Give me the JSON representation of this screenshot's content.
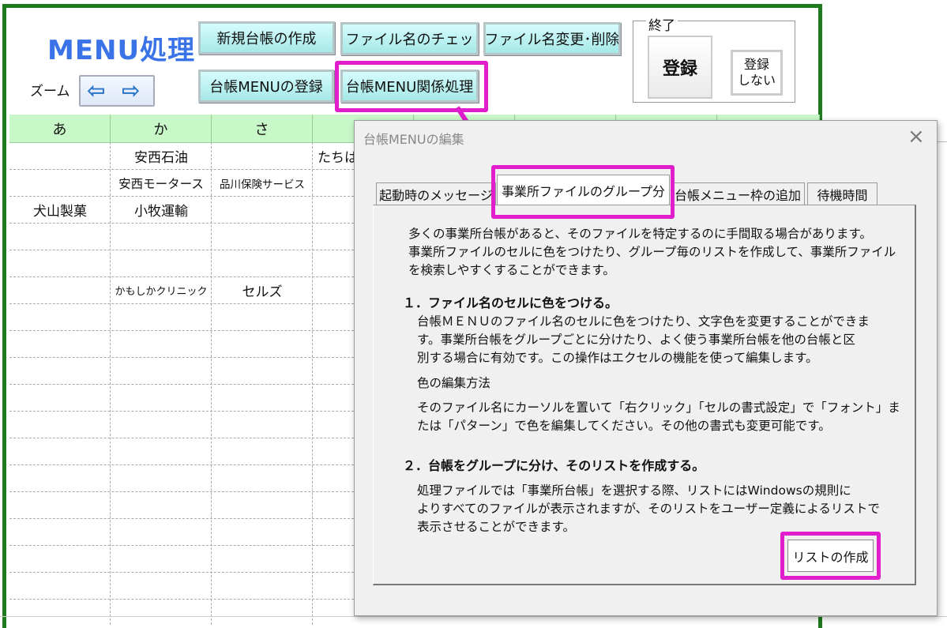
{
  "menu": {
    "title": "MENU処理",
    "zoom_label": "ズーム",
    "zoom_left_icon": "⇦",
    "zoom_right_icon": "⇨",
    "buttons": {
      "new_ledger": "新規台帳の作成",
      "check_filename": "ファイル名のチェッ",
      "rename_delete": "ファイル名変更･削除",
      "register_menu": "台帳MENUの登録",
      "menu_related": "台帳MENU関係処理"
    },
    "exit_group": {
      "title": "終了",
      "register": "登録",
      "no_register_line1": "登録",
      "no_register_line2": "しない"
    }
  },
  "sheet": {
    "headers": [
      "あ",
      "か",
      "さ",
      ""
    ],
    "cells": {
      "r1_ka": "安西石油",
      "r1_ta": "たちは",
      "r2_ka": "安西モータース",
      "r2_sa": "品川保険サービス",
      "r3_a": "犬山製菓",
      "r3_ka": "小牧運輸",
      "r6_ka": "かもしかクリニック",
      "r6_sa": "セルズ"
    }
  },
  "dialog": {
    "title": "台帳MENUの編集",
    "close_icon": "×",
    "tabs": [
      "起動時のメッセージ",
      "事業所ファイルのグループ分",
      "台帳メニュー枠の追加",
      "待機時間"
    ],
    "active_tab": 1,
    "intro": [
      "多くの事業所台帳があると、そのファイルを特定するのに手間取る場合があります。",
      "事業所ファイルのセルに色をつけたり、グループ毎のリストを作成して、事業所ファイル",
      "を検索しやすくすることができます。"
    ],
    "section1": {
      "heading": "１．ファイル名のセルに色をつける。",
      "body": [
        "台帳ＭＥＮＵのファイル名のセルに色をつけたり、文字色を変更することができま",
        "す。事業所台帳をグループごとに分けたり、よく使う事業所台帳を他の台帳と区",
        "別する場合に有効です。この操作はエクセルの機能を使って編集します。"
      ],
      "subheading": "色の編集方法",
      "method": [
        "そのファイル名にカーソルを置いて「右クリック」「セルの書式設定」で「フォント」ま",
        "たは「パターン」で色を編集してください。その他の書式も変更可能です。"
      ]
    },
    "section2": {
      "heading": "２．台帳をグループに分け、そのリストを作成する。",
      "body": [
        "処理ファイルでは「事業所台帳」を選択する際、リストにはWindowsの規則に",
        "よりすべてのファイルが表示されますが、そのリストをユーザー定義によるリストで",
        "表示させることができます。"
      ]
    },
    "create_list_button": "リストの作成"
  },
  "colors": {
    "highlight": "#e01ecc",
    "title_blue": "#3a73e8",
    "button_cyan": "#a6e8e8",
    "header_green": "#c8f8c8",
    "sheet_border": "#1e7a1e"
  }
}
